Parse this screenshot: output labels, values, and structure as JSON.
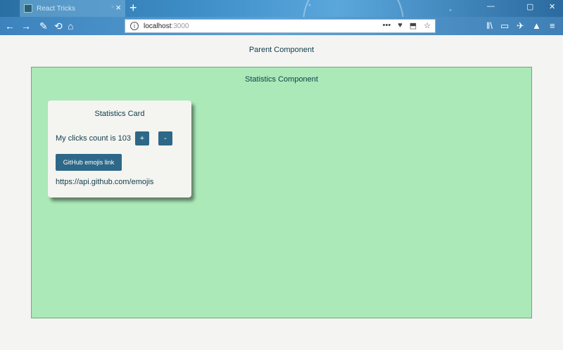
{
  "browser": {
    "tab_title": "React Tricks",
    "tab_close": "×",
    "new_tab": "+",
    "window_controls": {
      "minimize": "—",
      "maximize": "▢",
      "close": "✕"
    },
    "nav": {
      "back": "←",
      "forward": "→",
      "tools": "✎",
      "home": "⌂"
    },
    "url_host": "localhost",
    "url_port": ":3000",
    "url_actions": [
      "•••",
      "♥",
      "⬒",
      "☆"
    ],
    "toolbar_icons": [
      "ǁ\\",
      "▭",
      "✈",
      "▲",
      "≡"
    ]
  },
  "page": {
    "parent_title": "Parent Component",
    "statistics_title": "Statistics Component",
    "card": {
      "title": "Statistics Card",
      "clicks_prefix": "My clicks count is",
      "clicks_count": "103",
      "plus_label": "+",
      "minus_label": "-",
      "github_button_label": "GitHub emojis link",
      "api_url": "https://api.github.com/emojis"
    }
  },
  "colors": {
    "statistics_bg": "#abe9b8",
    "button_bg": "#2d6888",
    "text": "#103c4a"
  }
}
